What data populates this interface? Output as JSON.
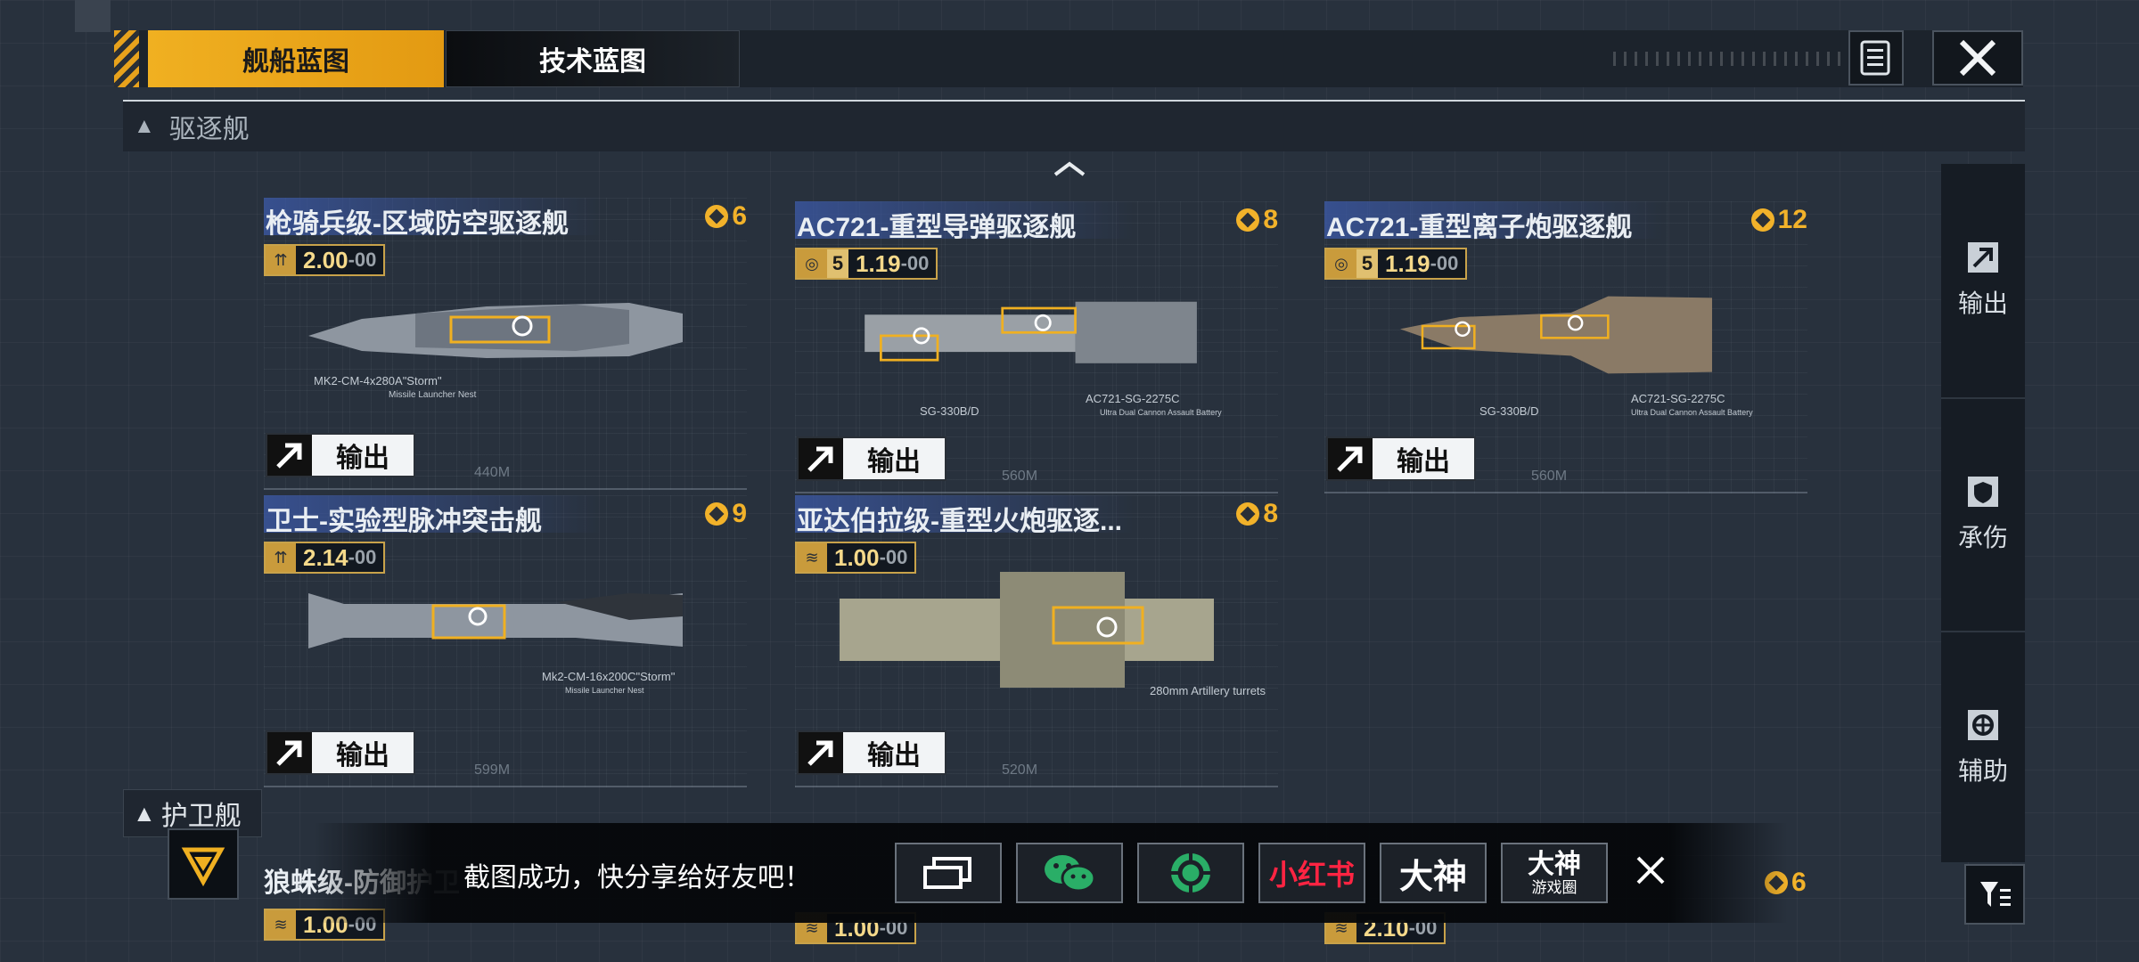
{
  "tabs": {
    "ship_blueprint": "舰船蓝图",
    "tech_blueprint": "技术蓝图"
  },
  "section_destroyer": "驱逐舰",
  "section_frigate": "护卫舰",
  "cards": [
    {
      "title": "枪骑兵级-区域防空驱逐舰",
      "cost": "6",
      "stat": "2.00",
      "stat_suffix": "-00",
      "level": "",
      "weapon": "MK2-CM-4x280A\"Storm\"",
      "weapon_sub": "Missile Launcher Nest",
      "length": "440M",
      "output": "输出"
    },
    {
      "title": "AC721-重型导弹驱逐舰",
      "cost": "8",
      "stat": "1.19",
      "stat_suffix": "-00",
      "level": "5",
      "weapon": "AC721-SG-2275C",
      "weapon_sub": "Ultra Dual Cannon Assault Battery",
      "weapon2": "SG-330B/D",
      "length": "560M",
      "output": "输出"
    },
    {
      "title": "AC721-重型离子炮驱逐舰",
      "cost": "12",
      "stat": "1.19",
      "stat_suffix": "-00",
      "level": "5",
      "weapon": "AC721-SG-2275C",
      "weapon_sub": "Ultra Dual Cannon Assault Battery",
      "weapon2": "SG-330B/D",
      "length": "560M",
      "output": "输出"
    },
    {
      "title": "卫士-实验型脉冲突击舰",
      "cost": "9",
      "stat": "2.14",
      "stat_suffix": "-00",
      "level": "",
      "weapon": "Mk2-CM-16x200C\"Storm\"",
      "weapon_sub": "Missile Launcher Nest",
      "length": "599M",
      "output": "输出"
    },
    {
      "title": "亚达伯拉级-重型火炮驱逐...",
      "cost": "8",
      "stat": "1.00",
      "stat_suffix": "-00",
      "level": "",
      "weapon": "280mm Artillery turrets",
      "weapon_sub": "",
      "length": "520M",
      "output": "输出"
    }
  ],
  "bottom_row": [
    {
      "title": "狼蛛级-防御护卫",
      "stat": "1.00",
      "stat_suffix": "-00"
    },
    {
      "title": "",
      "stat": "1.00",
      "stat_suffix": "-00"
    },
    {
      "title": "",
      "stat": "2.10",
      "stat_suffix": "-00",
      "cost": "6"
    }
  ],
  "side_panel": {
    "output": "输出",
    "defense": "承伤",
    "support": "辅助"
  },
  "toast": {
    "message": "截图成功，快分享给好友吧！",
    "share_xhs": "小红书",
    "share_dashen": "大神",
    "share_dashen2_top": "大神",
    "share_dashen2_bottom": "游戏圈"
  },
  "colors": {
    "accent": "#f0b021",
    "cost": "#f2b22a",
    "title_bar": "#3c5aaa",
    "wechat": "#2aae67",
    "xhs": "#ff2442"
  }
}
